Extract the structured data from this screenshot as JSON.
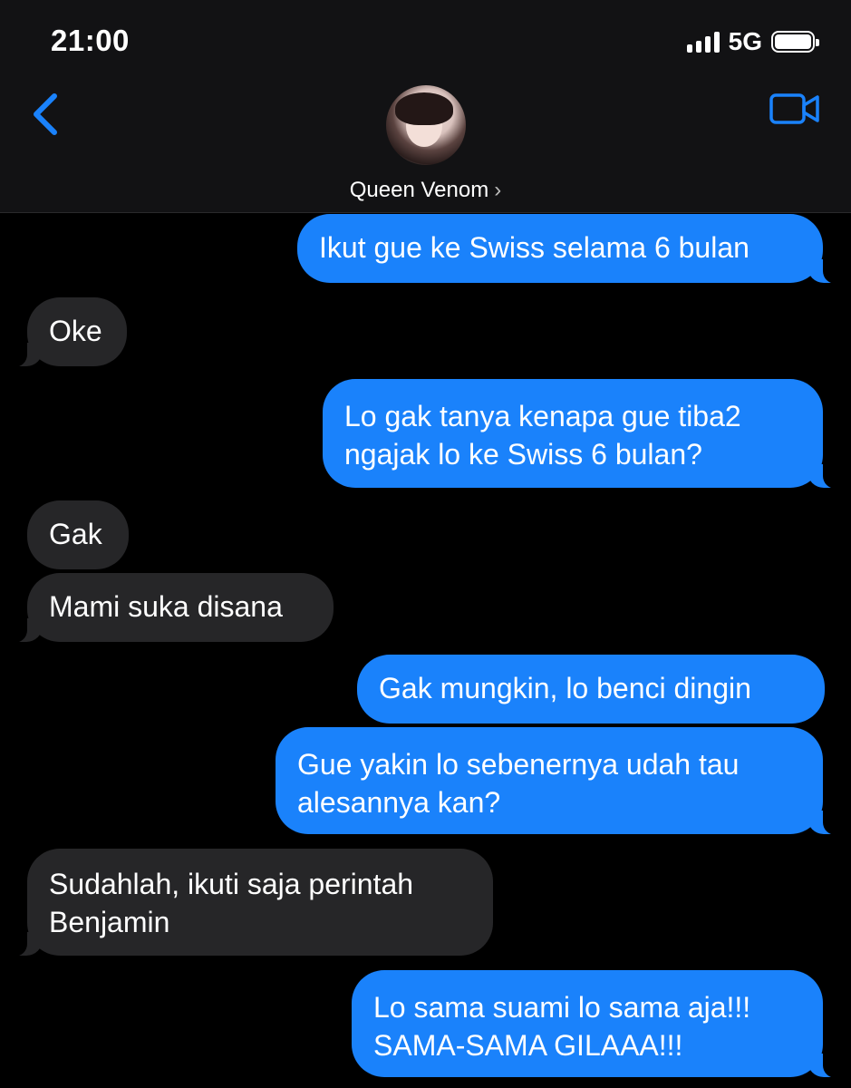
{
  "status_bar": {
    "time": "21:00",
    "network": "5G"
  },
  "header": {
    "contact_name": "Queen Venom",
    "chevron": "›"
  },
  "icons": {
    "back": "chevron-left-icon",
    "video": "video-camera-icon"
  },
  "colors": {
    "outgoing": "#1a82fb",
    "incoming": "#262628",
    "accent": "#1a82fb"
  },
  "messages": [
    {
      "from": "me",
      "lines": [
        "Ikut gue ke Swiss selama 6 bulan"
      ]
    },
    {
      "from": "them",
      "lines": [
        "Oke"
      ]
    },
    {
      "from": "me",
      "lines": [
        "Lo gak tanya kenapa gue tiba2",
        "ngajak lo ke Swiss 6 bulan?"
      ]
    },
    {
      "from": "them",
      "lines": [
        "Gak"
      ]
    },
    {
      "from": "them",
      "lines": [
        "Mami suka disana"
      ]
    },
    {
      "from": "me",
      "lines": [
        "Gak mungkin, lo benci dingin"
      ]
    },
    {
      "from": "me",
      "lines": [
        "Gue yakin lo sebenernya udah tau",
        "alesannya kan?"
      ]
    },
    {
      "from": "them",
      "lines": [
        "Sudahlah, ikuti saja perintah",
        "Benjamin"
      ]
    },
    {
      "from": "me",
      "lines": [
        "Lo sama suami lo sama aja!!!",
        "SAMA-SAMA GILAAA!!!"
      ]
    }
  ]
}
